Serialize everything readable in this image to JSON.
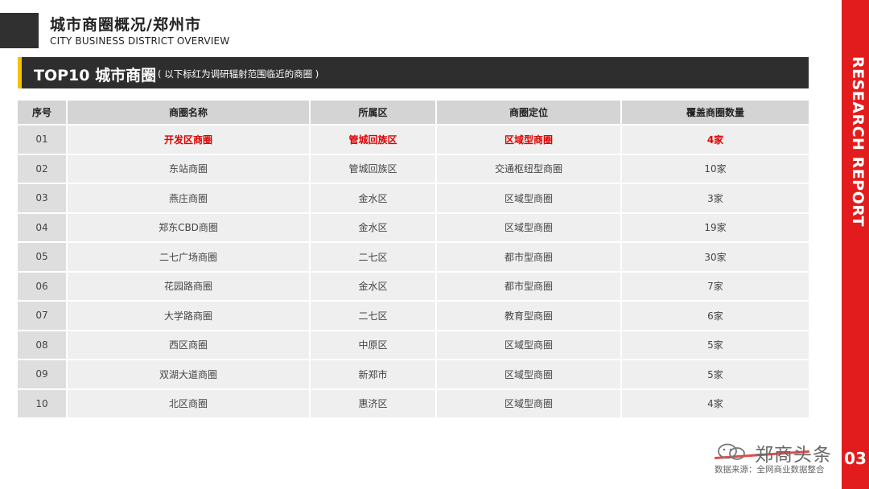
{
  "header": {
    "title": "城市商圈概况/郑州市",
    "subtitle": "CITY BUSINESS DISTRICT OVERVIEW"
  },
  "banner": {
    "title": "TOP10 城市商圈",
    "note": "( 以下标红为调研辐射范围临近的商圈 )"
  },
  "side_label": "RESEARCH REPORT",
  "page_number": "03",
  "table": {
    "headers": [
      "序号",
      "商圈名称",
      "所属区",
      "商圈定位",
      "覆盖商圈数量"
    ],
    "rows": [
      [
        "01",
        "开发区商圈",
        "管城回族区",
        "区域型商圈",
        "4家"
      ],
      [
        "02",
        "东站商圈",
        "管城回族区",
        "交通枢纽型商圈",
        "10家"
      ],
      [
        "03",
        "燕庄商圈",
        "金水区",
        "区域型商圈",
        "3家"
      ],
      [
        "04",
        "郑东CBD商圈",
        "金水区",
        "区域型商圈",
        "19家"
      ],
      [
        "05",
        "二七广场商圈",
        "二七区",
        "都市型商圈",
        "30家"
      ],
      [
        "06",
        "花园路商圈",
        "金水区",
        "都市型商圈",
        "7家"
      ],
      [
        "07",
        "大学路商圈",
        "二七区",
        "教育型商圈",
        "6家"
      ],
      [
        "08",
        "西区商圈",
        "中原区",
        "区域型商圈",
        "5家"
      ],
      [
        "09",
        "双湖大道商圈",
        "新郑市",
        "区域型商圈",
        "5家"
      ],
      [
        "10",
        "北区商圈",
        "惠济区",
        "区域型商圈",
        "4家"
      ]
    ],
    "highlight_color": "#e00000"
  },
  "footer": {
    "brand_icon": "wechat-icon",
    "brand": "郑商头条",
    "source": "数据来源：全网商业数据整合"
  },
  "colors": {
    "accent_red": "#e21c1c",
    "accent_yellow": "#f2c400",
    "banner_dark": "#2e2e2e"
  }
}
